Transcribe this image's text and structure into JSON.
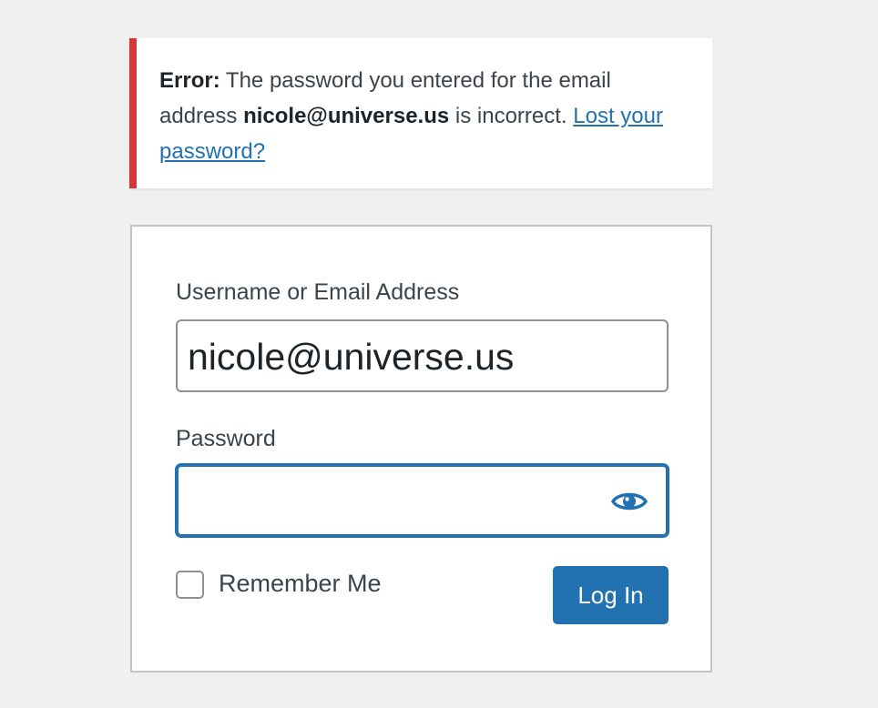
{
  "error_notice": {
    "prefix": "Error:",
    "text_before_email": " The password you entered for the email address ",
    "email": "nicole@universe.us",
    "text_after_email": " is incorrect. ",
    "link_text": "Lost your password?"
  },
  "login_form": {
    "username_label": "Username or Email Address",
    "username_value": "nicole@universe.us",
    "password_label": "Password",
    "password_value": "",
    "remember_label": "Remember Me",
    "remember_checked": false,
    "submit_label": "Log In"
  },
  "icons": {
    "show_password": "eye-icon"
  },
  "colors": {
    "background": "#f0f0f1",
    "error_accent": "#d63638",
    "primary": "#2271b1",
    "text": "#3c434a"
  }
}
